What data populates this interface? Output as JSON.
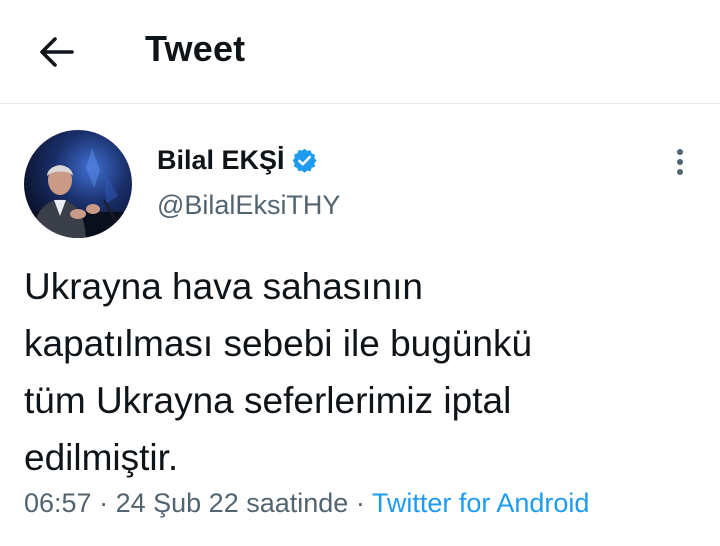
{
  "header": {
    "title": "Tweet"
  },
  "author": {
    "name": "Bilal EKŞİ",
    "handle": "@BilalEksiTHY",
    "verified": true
  },
  "tweet": {
    "text": "Ukrayna hava sahasının\nkapatılması sebebi ile bugünkü\ntüm Ukrayna seferlerimiz iptal\nedilmiştir.",
    "time": "06:57",
    "separator": "·",
    "date": "24 Şub 22 saatinde",
    "source": "Twitter for Android"
  },
  "colors": {
    "accent": "#1d9bf0",
    "secondary_text": "#536471",
    "primary_text": "#0f1419",
    "divider": "#e6ecf0"
  },
  "icons": {
    "back": "arrow-left-icon",
    "verified": "verified-badge-icon",
    "more": "more-vertical-icon"
  }
}
